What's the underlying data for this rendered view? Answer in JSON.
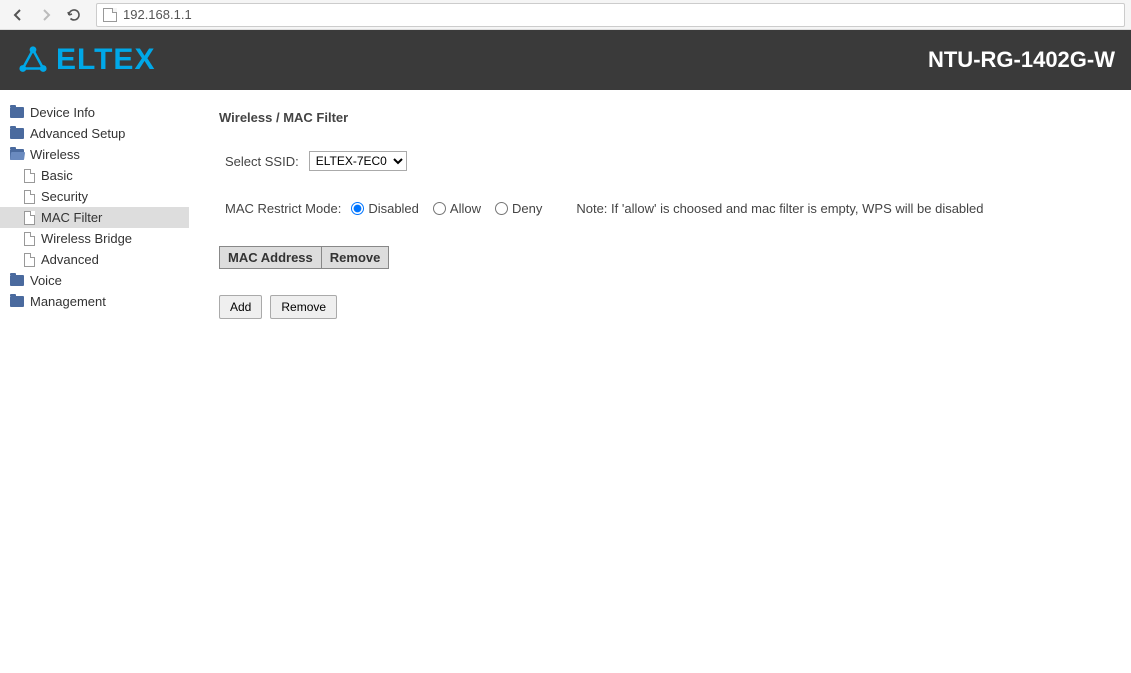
{
  "browser": {
    "url": "192.168.1.1"
  },
  "header": {
    "logo_text": "ΕLTEX",
    "model": "NTU-RG-1402G-W"
  },
  "sidebar": {
    "items": [
      {
        "label": "Device Info",
        "type": "folder"
      },
      {
        "label": "Advanced Setup",
        "type": "folder"
      },
      {
        "label": "Wireless",
        "type": "folder",
        "open": true
      },
      {
        "label": "Basic",
        "type": "file",
        "sub": true
      },
      {
        "label": "Security",
        "type": "file",
        "sub": true
      },
      {
        "label": "MAC Filter",
        "type": "file",
        "sub": true,
        "selected": true
      },
      {
        "label": "Wireless Bridge",
        "type": "file",
        "sub": true
      },
      {
        "label": "Advanced",
        "type": "file",
        "sub": true
      },
      {
        "label": "Voice",
        "type": "folder"
      },
      {
        "label": "Management",
        "type": "folder"
      }
    ]
  },
  "main": {
    "breadcrumb": "Wireless / MAC Filter",
    "ssid_label": "Select SSID:",
    "ssid_value": "ELTEX-7EC0",
    "restrict_label": "MAC Restrict Mode:",
    "restrict_options": {
      "disabled": "Disabled",
      "allow": "Allow",
      "deny": "Deny"
    },
    "note": "Note: If 'allow' is choosed and mac filter is empty, WPS will be disabled",
    "table": {
      "col_mac": "MAC Address",
      "col_remove": "Remove"
    },
    "buttons": {
      "add": "Add",
      "remove": "Remove"
    }
  }
}
